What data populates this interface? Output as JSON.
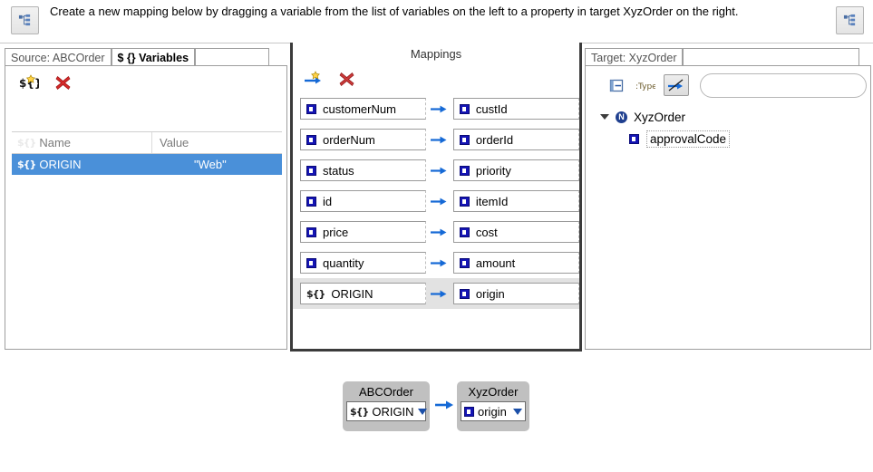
{
  "header": {
    "instruction": "Create a new mapping below by dragging a variable from the list of variables on the left to a property in target XyzOrder on the right.",
    "left_button_icon": "tree-hierarchy-icon",
    "right_button_icon": "tree-hierarchy-icon"
  },
  "source_panel": {
    "tabs": [
      {
        "label": "Source: ABCOrder",
        "active": false
      },
      {
        "label": "$ {} Variables",
        "active": true
      }
    ],
    "toolbar": {
      "add_label": "$ {}",
      "add_title": "Add variable",
      "delete_title": "Delete variable"
    },
    "table": {
      "columns": [
        "$ {} Name",
        "Value"
      ],
      "name_header": "Name",
      "value_header": "Value",
      "rows": [
        {
          "name": "ORIGIN",
          "value": "\"Web\"",
          "selected": true
        }
      ]
    }
  },
  "mappings_panel": {
    "title": "Mappings",
    "toolbar": {
      "add_title": "Add mapping",
      "delete_title": "Delete mapping"
    },
    "rows": [
      {
        "source": "customerNum",
        "source_kind": "property",
        "target": "custId",
        "target_kind": "property",
        "selected": false
      },
      {
        "source": "orderNum",
        "source_kind": "property",
        "target": "orderId",
        "target_kind": "property",
        "selected": false
      },
      {
        "source": "status",
        "source_kind": "property",
        "target": "priority",
        "target_kind": "property",
        "selected": false
      },
      {
        "source": "id",
        "source_kind": "property",
        "target": "itemId",
        "target_kind": "property",
        "selected": false
      },
      {
        "source": "price",
        "source_kind": "property",
        "target": "cost",
        "target_kind": "property",
        "selected": false
      },
      {
        "source": "quantity",
        "source_kind": "property",
        "target": "amount",
        "target_kind": "property",
        "selected": false
      },
      {
        "source": "ORIGIN",
        "source_kind": "variable",
        "target": "origin",
        "target_kind": "property",
        "selected": true
      }
    ]
  },
  "target_panel": {
    "tabs": [
      {
        "label": "Target: XyzOrder",
        "active": true
      }
    ],
    "toolbar": {
      "collapse_title": "Collapse all",
      "type_label": ":Type",
      "type_title": "Show types",
      "toggle_title": "Hide unmapped",
      "toggle_pressed": true
    },
    "search": {
      "value": "",
      "placeholder": ""
    },
    "tree": {
      "root": {
        "label": "XyzOrder",
        "kind": "node",
        "expanded": true
      },
      "children": [
        {
          "label": "approvalCode",
          "kind": "property",
          "focused": true
        }
      ]
    }
  },
  "diagram": {
    "left": {
      "title": "ABCOrder",
      "selected": "ORIGIN",
      "selected_kind": "variable"
    },
    "right": {
      "title": "XyzOrder",
      "selected": "origin",
      "selected_kind": "property"
    },
    "arrow": "arrow-right-icon"
  },
  "colors": {
    "selection_blue": "#4a90d9",
    "arrow_blue": "#1569d6",
    "panel_border": "#3b3b3b",
    "property_icon": "#1414b4"
  }
}
